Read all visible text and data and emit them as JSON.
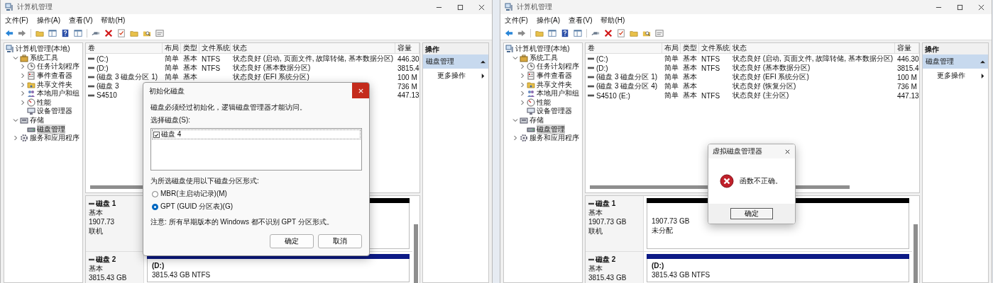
{
  "windows": [
    {
      "title": "计算机管理",
      "menu": [
        "文件(F)",
        "操作(A)",
        "查看(V)",
        "帮助(H)"
      ],
      "tree": [
        {
          "label": "计算机管理(本地)",
          "selected": false,
          "children": [
            {
              "label": "系统工具",
              "expanded": true,
              "selected": false,
              "children": [
                {
                  "label": "任务计划程序",
                  "expanded": false,
                  "selected": false
                },
                {
                  "label": "事件查看器",
                  "expanded": false,
                  "selected": false
                },
                {
                  "label": "共享文件夹",
                  "expanded": false,
                  "selected": false
                },
                {
                  "label": "本地用户和组",
                  "expanded": false,
                  "selected": false
                },
                {
                  "label": "性能",
                  "expanded": false,
                  "selected": false
                },
                {
                  "label": "设备管理器",
                  "selected": false
                }
              ]
            },
            {
              "label": "存储",
              "expanded": true,
              "selected": false,
              "children": [
                {
                  "label": "磁盘管理",
                  "selected": true
                }
              ]
            },
            {
              "label": "服务和应用程序",
              "expanded": false,
              "selected": false
            }
          ]
        }
      ],
      "table": {
        "columns": [
          "卷",
          "布局",
          "类型",
          "文件系统",
          "状态",
          "容量"
        ],
        "rows": [
          [
            "(C:)",
            "简单",
            "基本",
            "NTFS",
            "状态良好 (启动, 页面文件, 故障转储, 基本数据分区)",
            "446.30"
          ],
          [
            "(D:)",
            "简单",
            "基本",
            "NTFS",
            "状态良好 (基本数据分区)",
            "3815.4"
          ],
          [
            "(磁盘 3 磁盘分区 1)",
            "简单",
            "基本",
            null,
            "状态良好 (EFI 系统分区)",
            "100 M"
          ],
          [
            "(磁盘 3",
            null,
            null,
            null,
            null,
            "736 M"
          ],
          [
            "S4510",
            null,
            null,
            null,
            null,
            "447.13"
          ]
        ]
      },
      "actions": {
        "title": "操作",
        "section": "磁盘管理",
        "items": [
          "更多操作"
        ]
      },
      "disks": [
        {
          "name": "磁盘 1",
          "type": "基本",
          "size": "1907.73",
          "status": "联机",
          "partition": {
            "kind": "unallocated"
          }
        },
        {
          "name": "磁盘 2",
          "type": "基本",
          "size": "3815.43 GB",
          "partition": {
            "kind": "primary",
            "label": "(D:)",
            "lines": [
              "3815.43 GB NTFS"
            ]
          }
        }
      ],
      "dialog": {
        "kind": "initialize",
        "title": "初始化磁盘",
        "close_highlighted": true,
        "message": "磁盘必须经过初始化，逻辑磁盘管理器才能访问。",
        "list_label": "选择磁盘(S):",
        "disks": [
          {
            "label": "磁盘 4",
            "checked": true
          }
        ],
        "style_label": "为所选磁盘使用以下磁盘分区形式:",
        "options": [
          {
            "label": "MBR(主启动记录)(M)",
            "selected": false
          },
          {
            "label": "GPT (GUID 分区表)(G)",
            "selected": true
          }
        ],
        "note": "注意: 所有早期版本的 Windows 都不识别 GPT 分区形式。",
        "buttons": [
          "确定",
          "取消"
        ]
      }
    },
    {
      "title": "计算机管理",
      "menu": [
        "文件(F)",
        "操作(A)",
        "查看(V)",
        "帮助(H)"
      ],
      "tree": [
        {
          "label": "计算机管理(本地)",
          "selected": false,
          "children": [
            {
              "label": "系统工具",
              "expanded": true,
              "selected": false,
              "children": [
                {
                  "label": "任务计划程序",
                  "expanded": false,
                  "selected": false
                },
                {
                  "label": "事件查看器",
                  "expanded": false,
                  "selected": false
                },
                {
                  "label": "共享文件夹",
                  "expanded": false,
                  "selected": false
                },
                {
                  "label": "本地用户和组",
                  "expanded": false,
                  "selected": false
                },
                {
                  "label": "性能",
                  "expanded": false,
                  "selected": false
                },
                {
                  "label": "设备管理器",
                  "selected": false
                }
              ]
            },
            {
              "label": "存储",
              "expanded": true,
              "selected": false,
              "children": [
                {
                  "label": "磁盘管理",
                  "selected": true
                }
              ]
            },
            {
              "label": "服务和应用程序",
              "expanded": false,
              "selected": false
            }
          ]
        }
      ],
      "table": {
        "columns": [
          "卷",
          "布局",
          "类型",
          "文件系统",
          "状态",
          "容量"
        ],
        "rows": [
          [
            "(C:)",
            "简单",
            "基本",
            "NTFS",
            "状态良好 (启动, 页面文件, 故障转储, 基本数据分区)",
            "446.30"
          ],
          [
            "(D:)",
            "简单",
            "基本",
            "NTFS",
            "状态良好 (基本数据分区)",
            "3815.4"
          ],
          [
            "(磁盘 3 磁盘分区 1)",
            "简单",
            "基本",
            null,
            "状态良好 (EFI 系统分区)",
            "100 M"
          ],
          [
            "(磁盘 3 磁盘分区 4)",
            "简单",
            "基本",
            null,
            "状态良好 (恢复分区)",
            "736 M"
          ],
          [
            "S4510 (E:)",
            "简单",
            "基本",
            "NTFS",
            "状态良好 (主分区)",
            "447.13"
          ]
        ]
      },
      "actions": {
        "title": "操作",
        "section": "磁盘管理",
        "items": [
          "更多操作"
        ]
      },
      "disks": [
        {
          "name": "磁盘 1",
          "type": "基本",
          "size": "1907.73 GB",
          "status": "联机",
          "partition": {
            "kind": "unallocated",
            "lines": [
              "1907.73 GB",
              "未分配"
            ]
          }
        },
        {
          "name": "磁盘 2",
          "type": "基本",
          "size": "3815.43 GB",
          "partition": {
            "kind": "primary",
            "label": "(D:)",
            "lines": [
              "3815.43 GB NTFS"
            ]
          }
        }
      ],
      "dialog": {
        "kind": "error",
        "title": "虚拟磁盘管理器",
        "close_highlighted": false,
        "message": "函数不正确。",
        "buttons": [
          "确定"
        ]
      }
    }
  ]
}
